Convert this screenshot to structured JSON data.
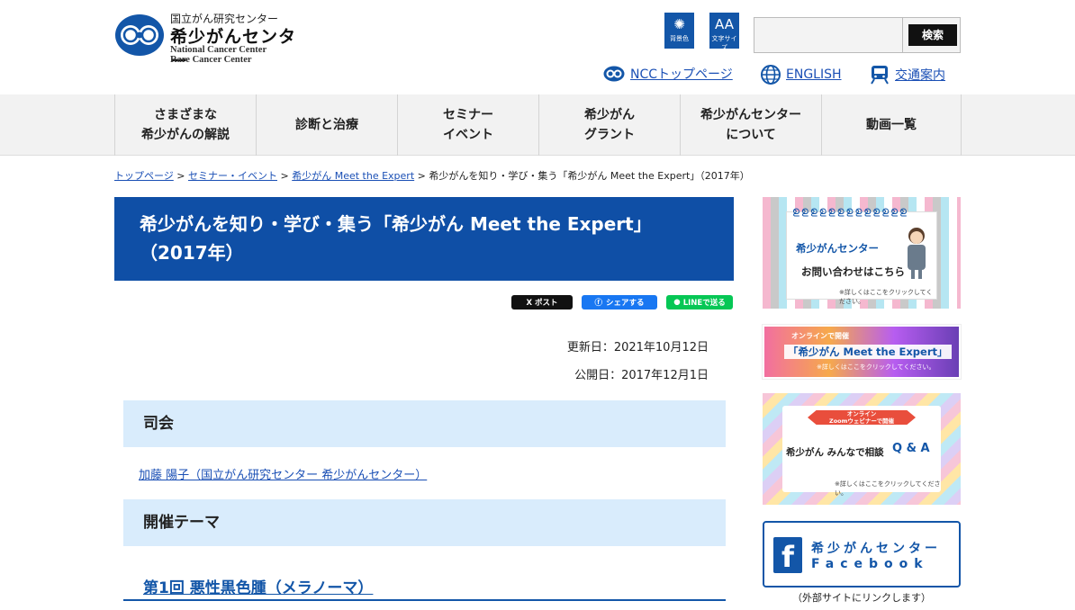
{
  "header": {
    "logo": {
      "subtitle_jp": "国立がん研究センター",
      "title_jp": "希少がんセンター",
      "en_line1": "National Cancer Center",
      "en_line2": "Rare Cancer Center"
    },
    "tools": {
      "bg_color_label": "背景色",
      "font_size_label": "文字サイズ",
      "font_size_glyph": "AA"
    },
    "search": {
      "placeholder": "",
      "button_label": "検索"
    },
    "links": [
      {
        "label": "NCCトップページ",
        "icon": "ncc-logo-icon"
      },
      {
        "label": "ENGLISH",
        "icon": "globe-icon"
      },
      {
        "label": "交通案内",
        "icon": "train-icon"
      }
    ]
  },
  "nav": {
    "items": [
      {
        "line1": "さまざまな",
        "line2": "希少がんの解説"
      },
      {
        "line1": "診断と治療",
        "line2": ""
      },
      {
        "line1": "セミナー",
        "line2": "イベント"
      },
      {
        "line1": "希少がん",
        "line2": "グラント"
      },
      {
        "line1": "希少がんセンター",
        "line2": "について"
      },
      {
        "line1": "動画一覧",
        "line2": ""
      }
    ]
  },
  "breadcrumb": {
    "home": "トップページ",
    "sep": ">",
    "seminar": "セミナー・イベント",
    "meet": "希少がん Meet the Expert",
    "current": "希少がんを知り・学び・集う「希少がん Meet the Expert」（2017年）"
  },
  "page": {
    "title_line1": "希少がんを知り・学び・集う「希少がん Meet the Expert」",
    "title_line2": "（2017年）",
    "share": {
      "x": "X ポスト",
      "facebook": "シェアする",
      "line": "LINEで送る"
    },
    "updated": "更新日：2021年10月12日",
    "published": "公開日：2017年12月1日",
    "section_host": "司会",
    "host_link": "加藤 陽子（国立がん研究センター 希少がんセンター）",
    "section_theme": "開催テーマ",
    "theme_1": "第1回 悪性黒色腫（メラノーマ）"
  },
  "sidebar": {
    "contact": {
      "title": "希少がんセンター",
      "text": "お問い合わせはこちら",
      "note": "※詳しくはここをクリックしてください。"
    },
    "online": {
      "tag": "オンラインで開催",
      "title": "「希少がん Meet the Expert」",
      "note": "※詳しくはここをクリックしてください。"
    },
    "qa": {
      "tag1": "オンライン",
      "tag2": "Zoomウェビナーで開催",
      "title": "希少がん みんなで相談",
      "qa": "Q & A",
      "note": "※詳しくはここをクリックしてください。"
    },
    "facebook": {
      "line1": "希少がんセンター",
      "line2": "Facebook",
      "note": "（外部サイトにリンクします）"
    }
  },
  "colors": {
    "primary": "#0f4fa6",
    "section_bg": "#d9ecfc",
    "nav_bg": "#f2f2f2",
    "link": "#1a4fb5"
  }
}
